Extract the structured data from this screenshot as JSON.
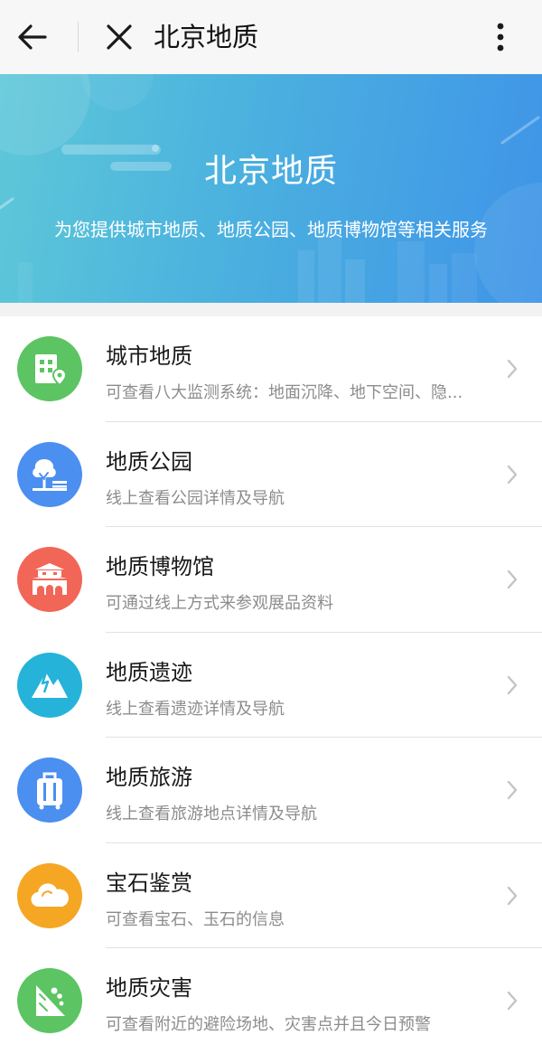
{
  "topbar": {
    "title": "北京地质",
    "back_icon": "arrow-left-icon",
    "close_icon": "close-icon",
    "more_icon": "more-vertical-icon"
  },
  "banner": {
    "title": "北京地质",
    "subtitle": "为您提供城市地质、地质公园、地质博物馆等相关服务",
    "colors": [
      "#5ec8d8",
      "#3f94e8"
    ]
  },
  "services": [
    {
      "title": "城市地质",
      "desc": "可查看八大监测系统：地面沉降、地下空间、隐...",
      "icon": "building-location-icon",
      "color": "#5cc463"
    },
    {
      "title": "地质公园",
      "desc": "线上查看公园详情及导航",
      "icon": "park-tree-bench-icon",
      "color": "#4b8ff0"
    },
    {
      "title": "地质博物馆",
      "desc": "可通过线上方式来参观展品资料",
      "icon": "museum-gate-icon",
      "color": "#f26657"
    },
    {
      "title": "地质遗迹",
      "desc": "线上查看遗迹详情及导航",
      "icon": "mountain-icon",
      "color": "#26b3d9"
    },
    {
      "title": "地质旅游",
      "desc": "线上查看旅游地点详情及导航",
      "icon": "suitcase-icon",
      "color": "#4b8ff0"
    },
    {
      "title": "宝石鉴赏",
      "desc": "可查看宝石、玉石的信息",
      "icon": "cloud-gem-icon",
      "color": "#f5a623"
    },
    {
      "title": "地质灾害",
      "desc": "可查看附近的避险场地、灾害点并且今日预警",
      "icon": "landslide-icon",
      "color": "#5cc463"
    }
  ],
  "chevron_icon": "chevron-right-icon"
}
